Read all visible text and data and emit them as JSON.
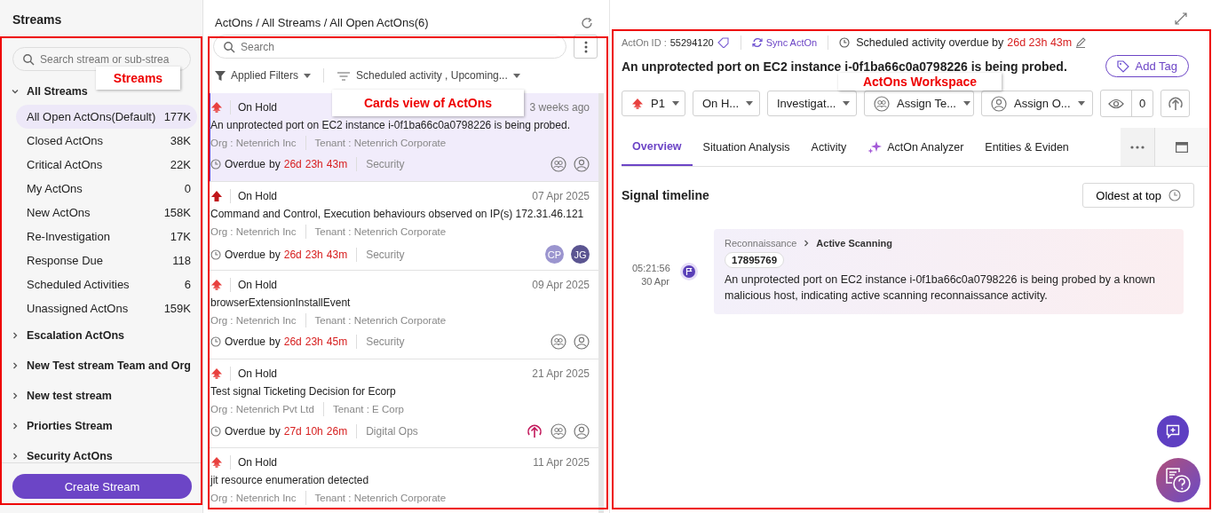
{
  "streams_panel": {
    "title": "Streams",
    "search": {
      "placeholder": "Search stream or sub-strea"
    },
    "groups": [
      {
        "label": "All Streams",
        "expanded": true,
        "children": [
          {
            "label": "All Open ActOns(Default)",
            "count": "177K",
            "selected": true
          },
          {
            "label": "Closed ActOns",
            "count": "38K",
            "selected": false
          },
          {
            "label": "Critical ActOns",
            "count": "22K",
            "selected": false
          },
          {
            "label": "My ActOns",
            "count": "0",
            "selected": false
          },
          {
            "label": "New ActOns",
            "count": "158K",
            "selected": false
          },
          {
            "label": "Re-Investigation",
            "count": "17K",
            "selected": false
          },
          {
            "label": "Response Due",
            "count": "118",
            "selected": false
          },
          {
            "label": "Scheduled Activities",
            "count": "6",
            "selected": false
          },
          {
            "label": "Unassigned ActOns",
            "count": "159K",
            "selected": false
          }
        ]
      },
      {
        "label": "Escalation ActOns",
        "expanded": false
      },
      {
        "label": "New Test stream Team and Org",
        "expanded": false
      },
      {
        "label": "New test stream",
        "expanded": false
      },
      {
        "label": "Priorties Stream",
        "expanded": false
      },
      {
        "label": "Security ActOns",
        "expanded": false
      }
    ],
    "create_button": "Create Stream"
  },
  "cards_panel": {
    "breadcrumb": "ActOns / All Streams / All Open ActOns(6)",
    "search": {
      "placeholder": "Search"
    },
    "filters": [
      {
        "kind": "funnel",
        "label": "Applied Filters"
      },
      {
        "kind": "sort",
        "label": "Scheduled activity , Upcoming..."
      }
    ],
    "cards": [
      {
        "critical": false,
        "status": "On Hold",
        "time": "3 weeks ago",
        "title": "An unprotected port on EC2 instance i-0f1ba66c0a0798226 is being probed.",
        "org": "Org : Netenrich Inc",
        "tenant": "Tenant : Netenrich Corporate",
        "overdue": {
          "label": "Overdue",
          "by": "by",
          "days": "26d",
          "hours": "23h",
          "minutes": "43m"
        },
        "category": "Security",
        "escalated": false,
        "selected": true
      },
      {
        "critical": true,
        "status": "On Hold",
        "time": "07 Apr 2025",
        "title": "Command and Control, Execution behaviours observed on IP(s) 172.31.46.121",
        "org": "Org : Netenrich Inc",
        "tenant": "Tenant : Netenrich Corporate",
        "overdue": {
          "label": "Overdue",
          "by": "by",
          "days": "26d",
          "hours": "23h",
          "minutes": "43m"
        },
        "category": "Security",
        "escalated": false,
        "selected": false,
        "avatars": [
          {
            "initials": "CP",
            "color": "#9b95cf"
          },
          {
            "initials": "JG",
            "color": "#5b5591"
          }
        ]
      },
      {
        "critical": false,
        "status": "On Hold",
        "time": "09 Apr 2025",
        "title": "browserExtensionInstallEvent",
        "org": "Org : Netenrich Inc",
        "tenant": "Tenant : Netenrich Corporate",
        "overdue": {
          "label": "Overdue",
          "by": "by",
          "days": "26d",
          "hours": "23h",
          "minutes": "45m"
        },
        "category": "Security",
        "escalated": false,
        "selected": false
      },
      {
        "critical": false,
        "status": "On Hold",
        "time": "21 Apr 2025",
        "title": "Test signal Ticketing Decision for Ecorp",
        "org": "Org : Netenrich Pvt Ltd",
        "tenant": "Tenant : E Corp",
        "overdue": {
          "label": "Overdue",
          "by": "by",
          "days": "27d",
          "hours": "10h",
          "minutes": "26m"
        },
        "category": "Digital Ops",
        "escalated": true,
        "selected": false
      },
      {
        "critical": false,
        "status": "On Hold",
        "time": "11 Apr 2025",
        "title": "jit resource enumeration detected",
        "org": "Org : Netenrich Inc",
        "tenant": "Tenant : Netenrich Corporate",
        "selected": false
      }
    ]
  },
  "workspace": {
    "id_label": "ActOn ID :",
    "id": "55294120",
    "sync": "Sync ActOn",
    "schedule": {
      "label": "Scheduled activity overdue by",
      "value": "26d 23h 43m"
    },
    "title": "An unprotected port on EC2 instance i-0f1ba66c0a0798226 is being probed.",
    "add_tag": "Add Tag",
    "controls": [
      {
        "kind": "priority",
        "label": "P1"
      },
      {
        "kind": "plain",
        "label": "On H..."
      },
      {
        "kind": "plain",
        "label": "Investigat..."
      },
      {
        "kind": "team",
        "label": "Assign Te..."
      },
      {
        "kind": "user",
        "label": "Assign O..."
      }
    ],
    "watchers": "0",
    "tabs": [
      {
        "label": "Overview",
        "selected": true
      },
      {
        "label": "Situation Analysis",
        "selected": false
      },
      {
        "label": "Activity",
        "selected": false
      },
      {
        "label": "ActOn Analyzer",
        "selected": false,
        "kind": "ai"
      },
      {
        "label": "Entities & Eviden",
        "selected": false
      }
    ],
    "timeline": {
      "title": "Signal timeline",
      "sort_button": "Oldest at top",
      "events": [
        {
          "time": "05:21:56",
          "date": "30 Apr",
          "tactic": "Reconnaissance",
          "technique": "Active Scanning",
          "id": "17895769",
          "text": "An unprotected port on EC2 instance i-0f1ba66c0a0798226 is being probed by a known malicious host, indicating active scanning reconnaissance activity."
        }
      ]
    }
  },
  "annotations": [
    {
      "label": "Streams"
    },
    {
      "label": "Cards view of ActOns"
    },
    {
      "label": "ActOns Workspace"
    }
  ]
}
